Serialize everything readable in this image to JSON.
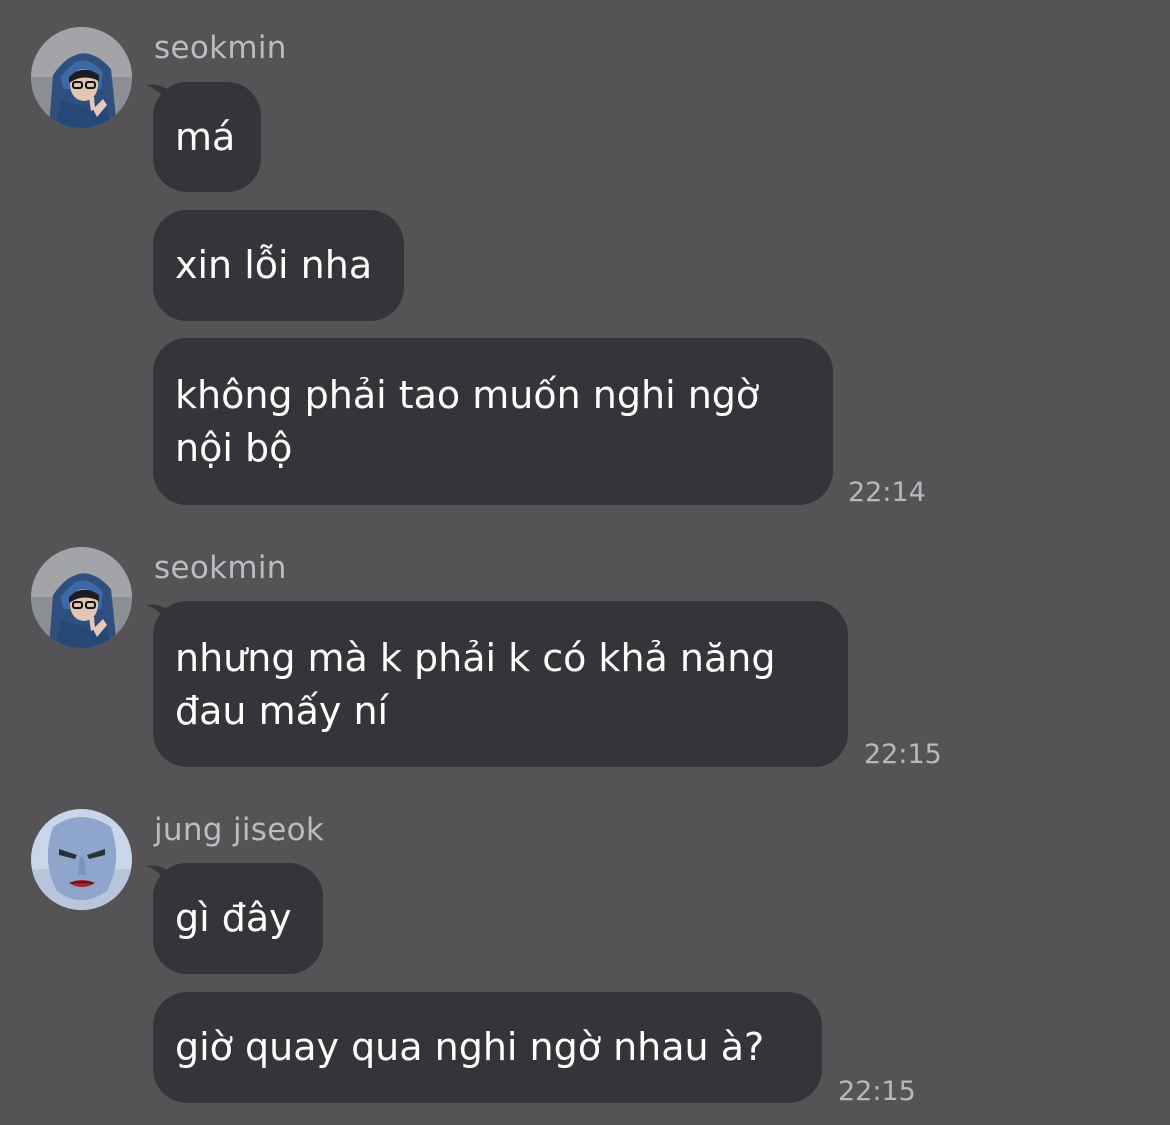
{
  "messages_group_1": {
    "sender": "seokmin",
    "bubbles": [
      "má",
      "xin lỗi nha",
      "không phải tao muốn nghi ngờ\nnội bộ"
    ],
    "time": "22:14"
  },
  "messages_group_2": {
    "sender": "seokmin",
    "bubbles": [
      "nhưng mà k phải k có khả năng\nđau mấy ní"
    ],
    "time": "22:15"
  },
  "messages_group_3": {
    "sender": "jung jiseok",
    "bubbles": [
      "gì đây",
      "giờ quay qua nghi ngờ nhau à?"
    ],
    "time": "22:15"
  },
  "colors": {
    "background": "#555355",
    "bubble": "#363438",
    "sender_text": "#bdbbc0",
    "timestamp": "#b9b7bc"
  },
  "icons": {
    "avatar_seokmin": "avatar-photo-hooded-person",
    "avatar_jiseok": "avatar-photo-pale-face"
  }
}
